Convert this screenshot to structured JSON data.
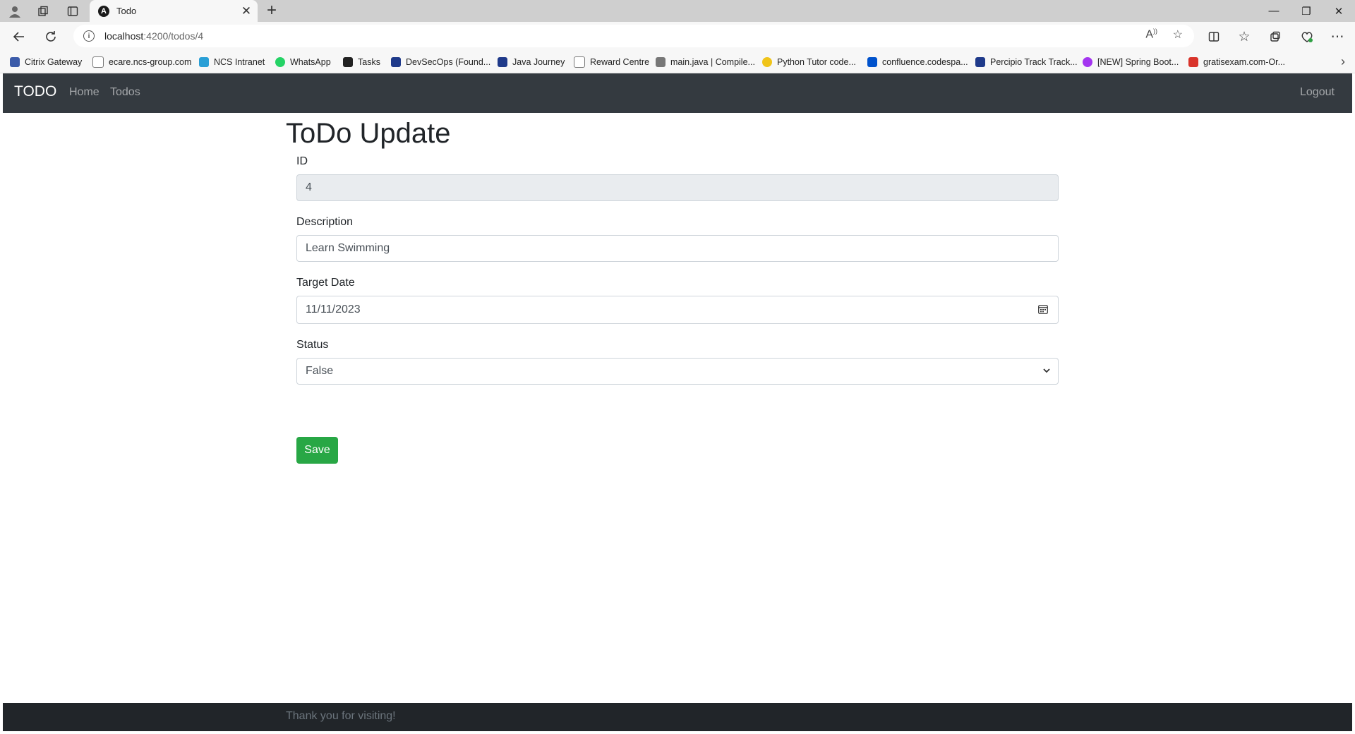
{
  "browser": {
    "tab_title": "Todo",
    "url_host": "localhost",
    "url_path": ":4200/todos/4",
    "new_tab_symbol": "+",
    "bookmarks": [
      {
        "label": "Citrix Gateway",
        "icon_color": "#3b5ba9"
      },
      {
        "label": "ecare.ncs-group.com",
        "icon_color": "#888888"
      },
      {
        "label": "NCS Intranet",
        "icon_color": "#2a9fd6"
      },
      {
        "label": "WhatsApp",
        "icon_color": "#25d366"
      },
      {
        "label": "Tasks",
        "icon_color": "#222222"
      },
      {
        "label": "DevSecOps (Found...",
        "icon_color": "#1f3a8a"
      },
      {
        "label": "Java Journey",
        "icon_color": "#1f3a8a"
      },
      {
        "label": "Reward Centre",
        "icon_color": "#888888"
      },
      {
        "label": "main.java | Compile...",
        "icon_color": "#777777"
      },
      {
        "label": "Python Tutor code...",
        "icon_color": "#f0c419"
      },
      {
        "label": "confluence.codespa...",
        "icon_color": "#0052cc"
      },
      {
        "label": "Percipio Track Track...",
        "icon_color": "#1f3a8a"
      },
      {
        "label": "[NEW] Spring Boot...",
        "icon_color": "#a435f0"
      },
      {
        "label": "gratisexam.com-Or...",
        "icon_color": "#d9342b"
      }
    ]
  },
  "navbar": {
    "brand": "TODO",
    "links": [
      "Home",
      "Todos"
    ],
    "logout": "Logout",
    "bg_color": "#343a40"
  },
  "form": {
    "title": "ToDo Update",
    "id_label": "ID",
    "id_value": "4",
    "description_label": "Description",
    "description_value": "Learn Swimming",
    "target_date_label": "Target Date",
    "target_date_value": "11/11/2023",
    "status_label": "Status",
    "status_value": "False",
    "save_label": "Save",
    "save_color": "#28a745"
  },
  "footer": {
    "text": "Thank you for visiting!"
  }
}
